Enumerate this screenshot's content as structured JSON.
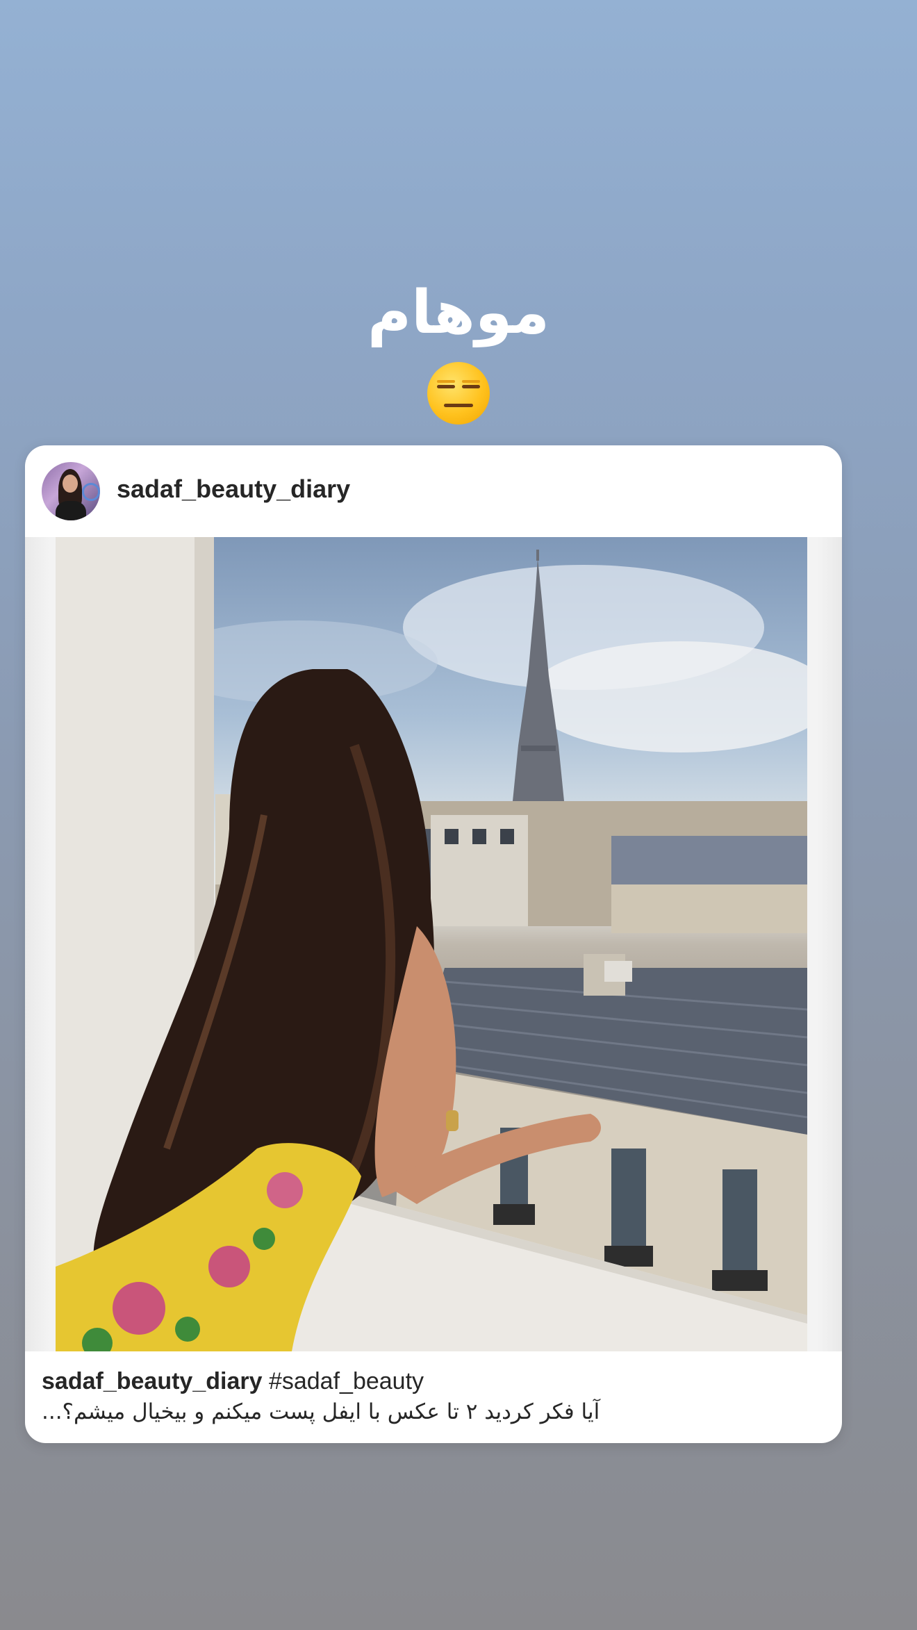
{
  "story": {
    "text": "موهام",
    "emoji": "expressionless-face"
  },
  "post": {
    "username": "sadaf_beauty_diary",
    "caption": {
      "username": "sadaf_beauty_diary",
      "hashtag": "#sadaf_beauty",
      "text": "آیا فکر کردید ۲ تا عکس با ایفل پست میکنم و بیخیال میشم؟..."
    },
    "photo_icon": "photo-woman-balcony-eiffel-tower"
  }
}
